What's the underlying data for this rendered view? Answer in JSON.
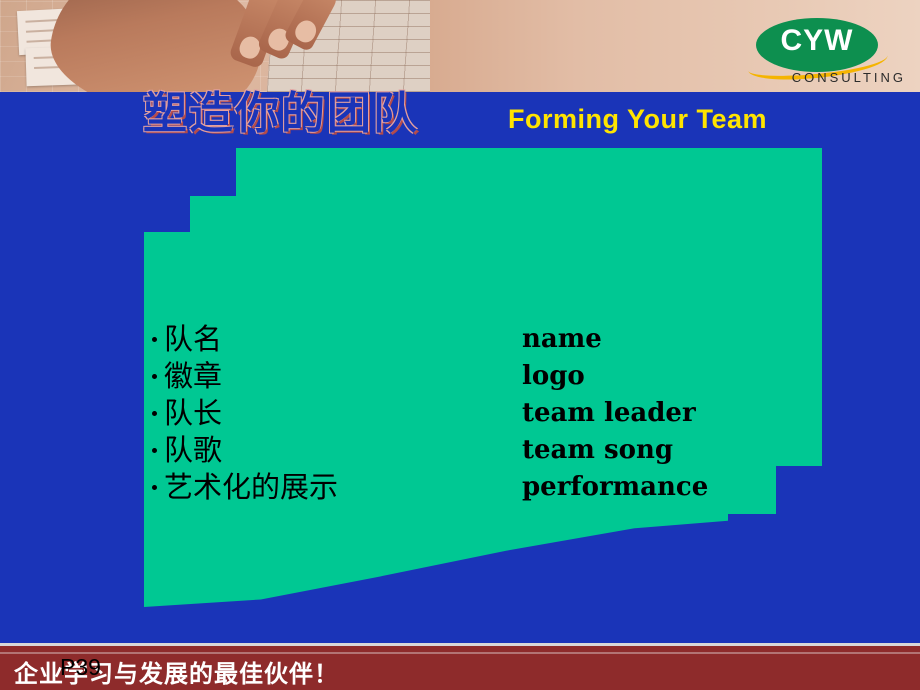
{
  "slide": {
    "title_cn": "塑造你的团队",
    "title_en": "Forming Your Team",
    "page_number": "P39",
    "bottom_slogan": "企业学习与发展的最佳伙伴！"
  },
  "logo": {
    "brand": "CYW",
    "subtitle": "CONSULTING"
  },
  "bullets": [
    {
      "cn": "队名",
      "en": "name"
    },
    {
      "cn": "徽章",
      "en": "logo"
    },
    {
      "cn": "队长",
      "en": "team leader"
    },
    {
      "cn": "队歌",
      "en": "team song"
    },
    {
      "cn": "艺术化的展示",
      "en": "performance"
    }
  ],
  "colors": {
    "background": "#1a34b8",
    "panel": "#00c893",
    "title_en": "#ffe400",
    "logo_green": "#0d8f4f",
    "logo_gold": "#f5b400",
    "bottom_bar": "#8e2b2b"
  }
}
